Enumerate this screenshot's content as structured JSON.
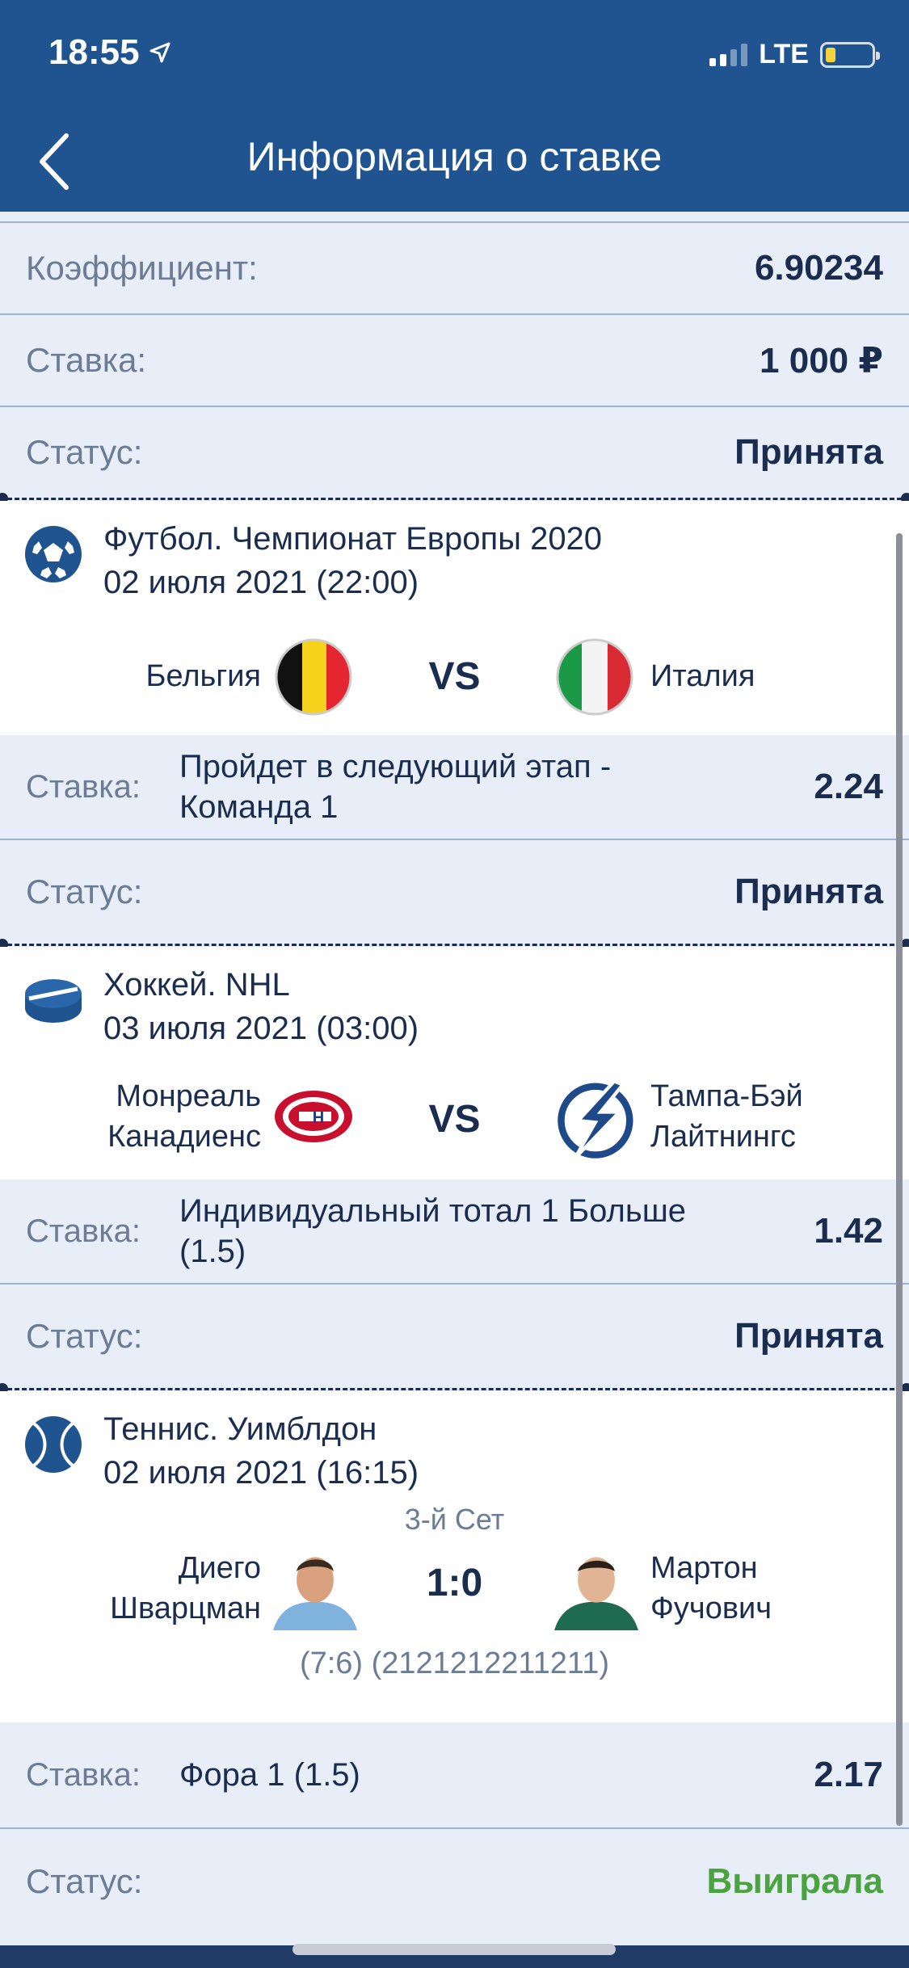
{
  "status": {
    "time": "18:55",
    "network": "LTE"
  },
  "header": {
    "title": "Информация о ставке"
  },
  "summary": [
    {
      "label": "Коэффициент:",
      "value": "6.90234"
    },
    {
      "label": "Ставка:",
      "value": "1 000 ₽"
    },
    {
      "label": "Статус:",
      "value": "Принята"
    }
  ],
  "events": [
    {
      "sport_line": "Футбол. Чемпионат Европы 2020",
      "date_line": "02 июля 2021 (22:00)",
      "team1": "Бельгия",
      "team2": "Италия",
      "center": "VS",
      "bet_label": "Ставка:",
      "bet_desc_1": "Пройдет в следующий этап -",
      "bet_desc_2": "Команда 1",
      "bet_odd": "2.24",
      "status_label": "Статус:",
      "status_value": "Принята",
      "icon": "soccer-ball-icon"
    },
    {
      "sport_line": "Хоккей. NHL",
      "date_line": "03 июля 2021 (03:00)",
      "team1_1": "Монреаль",
      "team1_2": "Канадиенс",
      "team2_1": "Тампа-Бэй",
      "team2_2": "Лайтнингс",
      "center": "VS",
      "bet_label": "Ставка:",
      "bet_desc_1": "Индивидуальный тотал 1 Больше",
      "bet_desc_2": "(1.5)",
      "bet_odd": "1.42",
      "status_label": "Статус:",
      "status_value": "Принята",
      "icon": "hockey-puck-icon"
    },
    {
      "sport_line": "Теннис. Уимблдон",
      "date_line": "02 июля 2021 (16:15)",
      "set": "3-й Сет",
      "team1_1": "Диего",
      "team1_2": "Шварцман",
      "team2_1": "Мартон",
      "team2_2": "Фучович",
      "center": "1:0",
      "set_scores": "(7:6) (2121212211211)",
      "bet_label": "Ставка:",
      "bet_desc_1": "Фора 1 (1.5)",
      "bet_odd": "2.17",
      "status_label": "Статус:",
      "status_value": "Выиграла",
      "icon": "tennis-ball-icon"
    }
  ],
  "colors": {
    "header": "#1f5491",
    "accent_win": "#4aa33e",
    "text": "#1a2d4f",
    "muted": "#6c7c95"
  }
}
